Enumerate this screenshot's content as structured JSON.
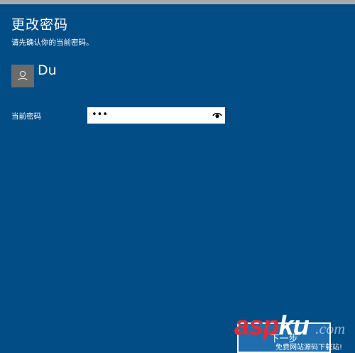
{
  "dialog": {
    "title": "更改密码",
    "subtitle": "请先确认你的当前密码。"
  },
  "user": {
    "name": "Du",
    "avatar_icon": "person-icon"
  },
  "current_password": {
    "label": "当前密码",
    "value": "•••",
    "reveal_icon": "eye-icon"
  },
  "next_button": {
    "label": "下一步"
  },
  "watermark": {
    "brand_red": "asp",
    "brand_white": "ku",
    "dotcom": ".com",
    "subtext": "免费网站源码下载站!"
  },
  "colors": {
    "background": "#034d87",
    "top_strip": "#a9a9a9",
    "avatar_bg": "#6b6b6b",
    "button_bg": "#1f6fb0",
    "brand_red": "#e8292f"
  }
}
